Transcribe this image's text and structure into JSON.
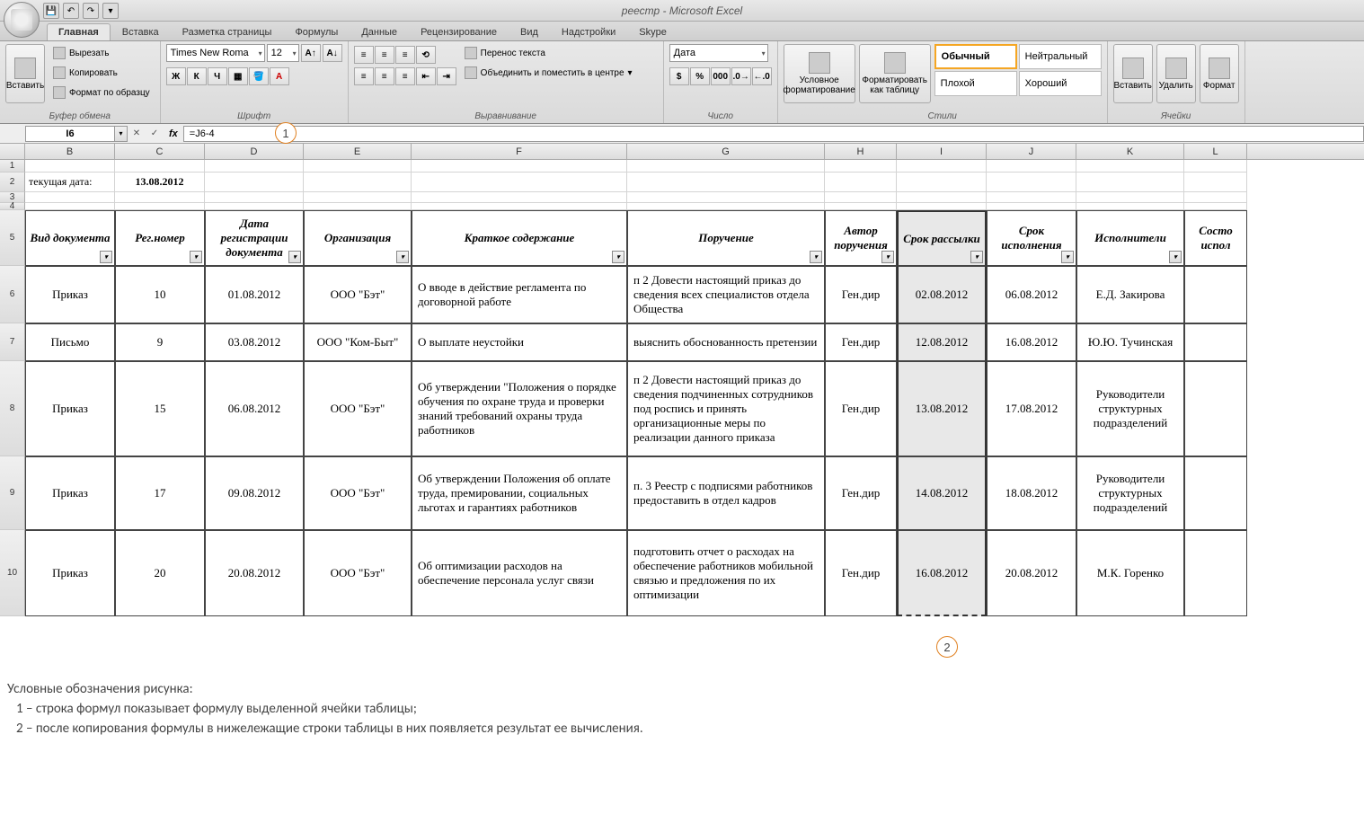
{
  "title": "реестр - Microsoft Excel",
  "qat": [
    "save-icon",
    "undo-icon",
    "redo-icon",
    "print-icon"
  ],
  "tabs": [
    "Главная",
    "Вставка",
    "Разметка страницы",
    "Формулы",
    "Данные",
    "Рецензирование",
    "Вид",
    "Надстройки",
    "Skype"
  ],
  "activeTab": 0,
  "ribbon": {
    "clipboard": {
      "paste": "Вставить",
      "cut": "Вырезать",
      "copy": "Копировать",
      "formatPainter": "Формат по образцу",
      "label": "Буфер обмена"
    },
    "font": {
      "name": "Times New Roma",
      "size": "12",
      "label": "Шрифт",
      "bold": "Ж",
      "italic": "К",
      "underline": "Ч"
    },
    "align": {
      "wrap": "Перенос текста",
      "merge": "Объединить и поместить в центре",
      "label": "Выравнивание"
    },
    "number": {
      "format": "Дата",
      "label": "Число",
      "pct": "%",
      "comma": "000"
    },
    "styles": {
      "cond": "Условное форматирование",
      "table": "Форматировать как таблицу",
      "normal": "Обычный",
      "neutral": "Нейтральный",
      "bad": "Плохой",
      "good": "Хороший",
      "label": "Стили"
    },
    "cells": {
      "insert": "Вставить",
      "delete": "Удалить",
      "format": "Формат",
      "label": "Ячейки"
    }
  },
  "namebox": "I6",
  "formula": "=J6-4",
  "columns": [
    "B",
    "C",
    "D",
    "E",
    "F",
    "G",
    "H",
    "I",
    "J",
    "K",
    "L"
  ],
  "row2": {
    "label": "текущая дата:",
    "value": "13.08.2012"
  },
  "headers": [
    "Вид документа",
    "Рег.номер",
    "Дата регистрации документа",
    "Организация",
    "Краткое содержание",
    "Поручение",
    "Автор поручения",
    "Срок рассылки",
    "Срок исполнения",
    "Исполнители",
    "Состо испол"
  ],
  "rows": [
    {
      "n": "6",
      "vid": "Приказ",
      "reg": "10",
      "date": "01.08.2012",
      "org": "ООО \"Бэт\"",
      "summary": "О вводе в действие регламента по договорной работе",
      "task": "п 2 Довести настоящий приказ до сведения всех специалистов отдела Общества",
      "author": "Ген.дир",
      "send": "02.08.2012",
      "due": "06.08.2012",
      "exec": "Е.Д. Закирова"
    },
    {
      "n": "7",
      "vid": "Письмо",
      "reg": "9",
      "date": "03.08.2012",
      "org": "ООО \"Ком-Быт\"",
      "summary": "О выплате неустойки",
      "task": "выяснить обоснованность претензии",
      "author": "Ген.дир",
      "send": "12.08.2012",
      "due": "16.08.2012",
      "exec": "Ю.Ю. Тучинская"
    },
    {
      "n": "8",
      "vid": "Приказ",
      "reg": "15",
      "date": "06.08.2012",
      "org": "ООО \"Бэт\"",
      "summary": "Об утверждении \"Положения о порядке обучения по охране труда и проверки знаний требований охраны труда работников",
      "task": "п 2 Довести настоящий приказ до сведения подчиненных сотрудников под роспись и принять организационные меры по реализации данного приказа",
      "author": "Ген.дир",
      "send": "13.08.2012",
      "due": "17.08.2012",
      "exec": "Руководители структурных подразделений"
    },
    {
      "n": "9",
      "vid": "Приказ",
      "reg": "17",
      "date": "09.08.2012",
      "org": "ООО \"Бэт\"",
      "summary": "Об утверждении Положения об оплате труда, премировании, социальных льготах и гарантиях работников",
      "task": "п. 3 Реестр с подписями работников предоставить в отдел кадров",
      "author": "Ген.дир",
      "send": "14.08.2012",
      "due": "18.08.2012",
      "exec": "Руководители структурных подразделений"
    },
    {
      "n": "10",
      "vid": "Приказ",
      "reg": "20",
      "date": "20.08.2012",
      "org": "ООО \"Бэт\"",
      "summary": "Об оптимизации расходов на обеспечение персонала услуг связи",
      "task": "подготовить отчет о расходах на обеспечение работников мобильной связью и предложения по их оптимизации",
      "author": "Ген.дир",
      "send": "16.08.2012",
      "due": "20.08.2012",
      "exec": "М.К. Горенко"
    }
  ],
  "callouts": {
    "c1": "1",
    "c2": "2"
  },
  "legend": {
    "title": "Условные обозначения рисунка:",
    "l1": "1 – строка формул показывает формулу выделенной ячейки таблицы;",
    "l2": "2 – после копирования формулы в нижележащие строки таблицы в них появляется результат ее вычисления."
  }
}
